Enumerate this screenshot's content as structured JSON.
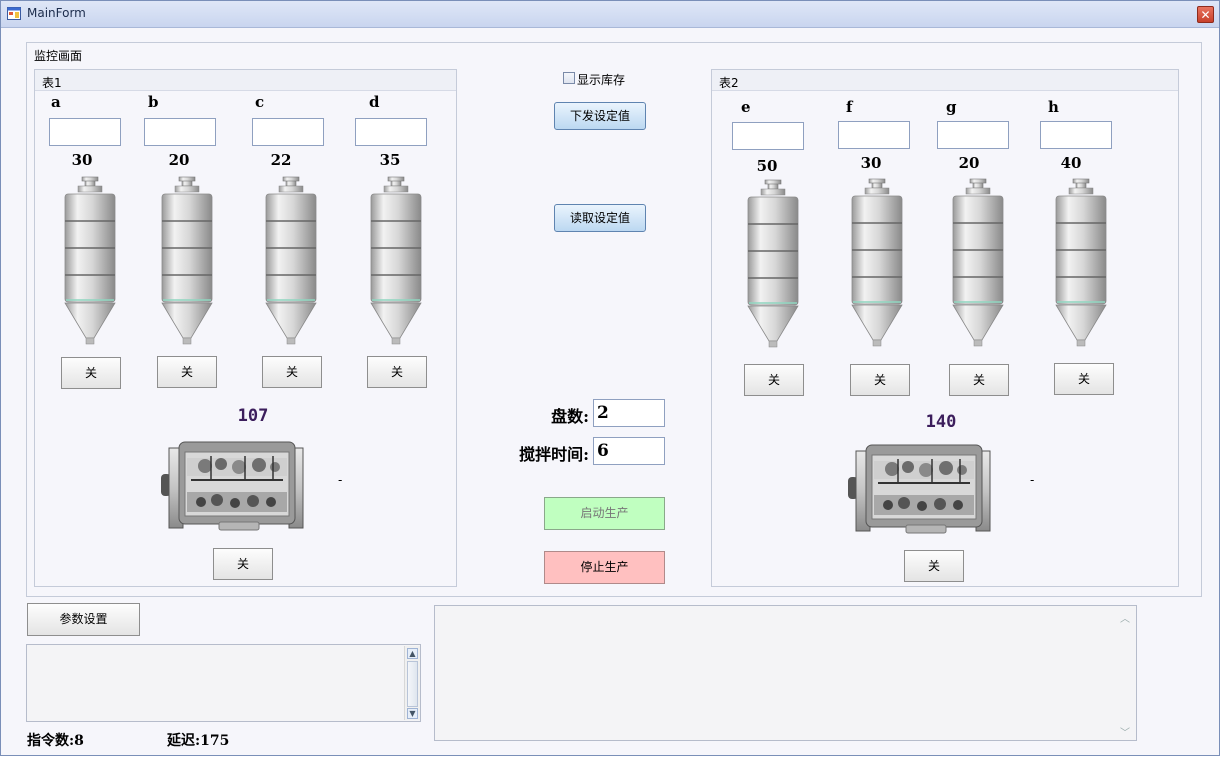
{
  "window": {
    "title": "MainForm",
    "close_glyph": "✕"
  },
  "monitor_group": {
    "title": "监控画面"
  },
  "table1": {
    "title": "表1",
    "tanks": [
      {
        "label": "a",
        "input": "",
        "value": "30",
        "button": "关"
      },
      {
        "label": "b",
        "input": "",
        "value": "20",
        "button": "关"
      },
      {
        "label": "c",
        "input": "",
        "value": "22",
        "button": "关"
      },
      {
        "label": "d",
        "input": "",
        "value": "35",
        "button": "关"
      }
    ],
    "mixer": {
      "value": "107",
      "dash": "-",
      "button": "关"
    }
  },
  "table2": {
    "title": "表2",
    "tanks": [
      {
        "label": "e",
        "input": "",
        "value": "50",
        "button": "关"
      },
      {
        "label": "f",
        "input": "",
        "value": "30",
        "button": "关"
      },
      {
        "label": "g",
        "input": "",
        "value": "20",
        "button": "关"
      },
      {
        "label": "h",
        "input": "",
        "value": "40",
        "button": "关"
      }
    ],
    "mixer": {
      "value": "140",
      "dash": "-",
      "button": "关"
    }
  },
  "center": {
    "show_stock_label": "显示库存",
    "show_stock_checked": false,
    "send_button": "下发设定值",
    "read_button": "读取设定值",
    "plates_label": "盘数:",
    "plates_value": "2",
    "mix_time_label": "搅拌时间:",
    "mix_time_value": "6",
    "start_button": "启动生产",
    "stop_button": "停止生产"
  },
  "bottom": {
    "param_button": "参数设置",
    "log_text": "",
    "output_text": "",
    "command_count": "指令数:8",
    "delay": "延迟:175"
  },
  "colors": {
    "start_bg": "#c0ffc0",
    "stop_bg": "#ffc0c0",
    "mixer_value": "#3c1e5c"
  },
  "icons": {
    "tank": "silo-icon",
    "mixer": "mixer-icon",
    "app": "form-icon"
  }
}
